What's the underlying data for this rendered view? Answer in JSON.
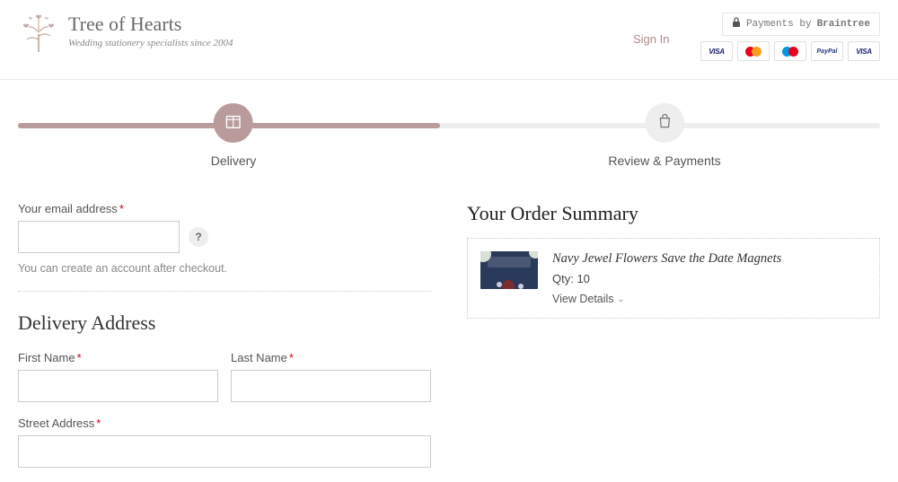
{
  "header": {
    "brand_title": "Tree of Hearts",
    "brand_tag": "Wedding stationery specialists since 2004",
    "signin": "Sign In",
    "braintree_prefix": "Payments by",
    "braintree_name": "Braintree",
    "cards": {
      "visa": "VISA",
      "paypal": "PayPal",
      "visa2": "VISA"
    }
  },
  "progress": {
    "step1": "Delivery",
    "step2": "Review & Payments"
  },
  "form": {
    "email_label": "Your email address",
    "email_value": "",
    "help": "?",
    "email_hint": "You can create an account after checkout.",
    "delivery_heading": "Delivery Address",
    "first_name_label": "First Name",
    "first_name_value": "",
    "last_name_label": "Last Name",
    "last_name_value": "",
    "street_label": "Street Address",
    "street_value": ""
  },
  "summary": {
    "title": "Your Order Summary",
    "item_name": "Navy Jewel Flowers Save the Date Magnets",
    "qty_label": "Qty: 10",
    "view_details": "View Details"
  }
}
